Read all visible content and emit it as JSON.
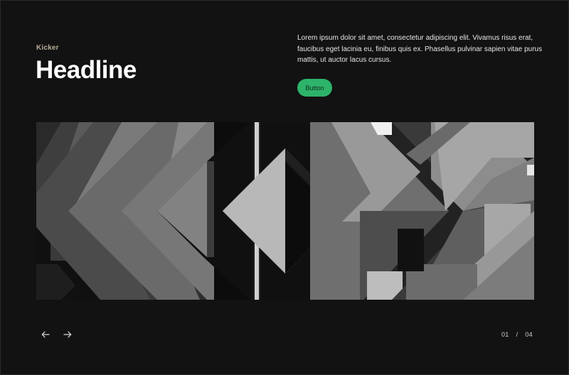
{
  "hero_section": {
    "kicker": "Kicker",
    "headline": "Headline",
    "body": "Lorem ipsum dolor sit amet, consectetur adipiscing elit. Vivamus risus erat, faucibus eget lacinia eu, finibus quis ex. Phasellus pulvinar sapien vitae purus mattis, ut auctor lacus cursus.",
    "button_label": "Button"
  },
  "slider": {
    "current": "01",
    "separator": "/",
    "total": "04",
    "prev_icon": "arrow-left-icon",
    "next_icon": "arrow-right-icon"
  },
  "colors": {
    "background": "#121212",
    "accent": "#2db36a",
    "kicker": "#b7ae97"
  }
}
